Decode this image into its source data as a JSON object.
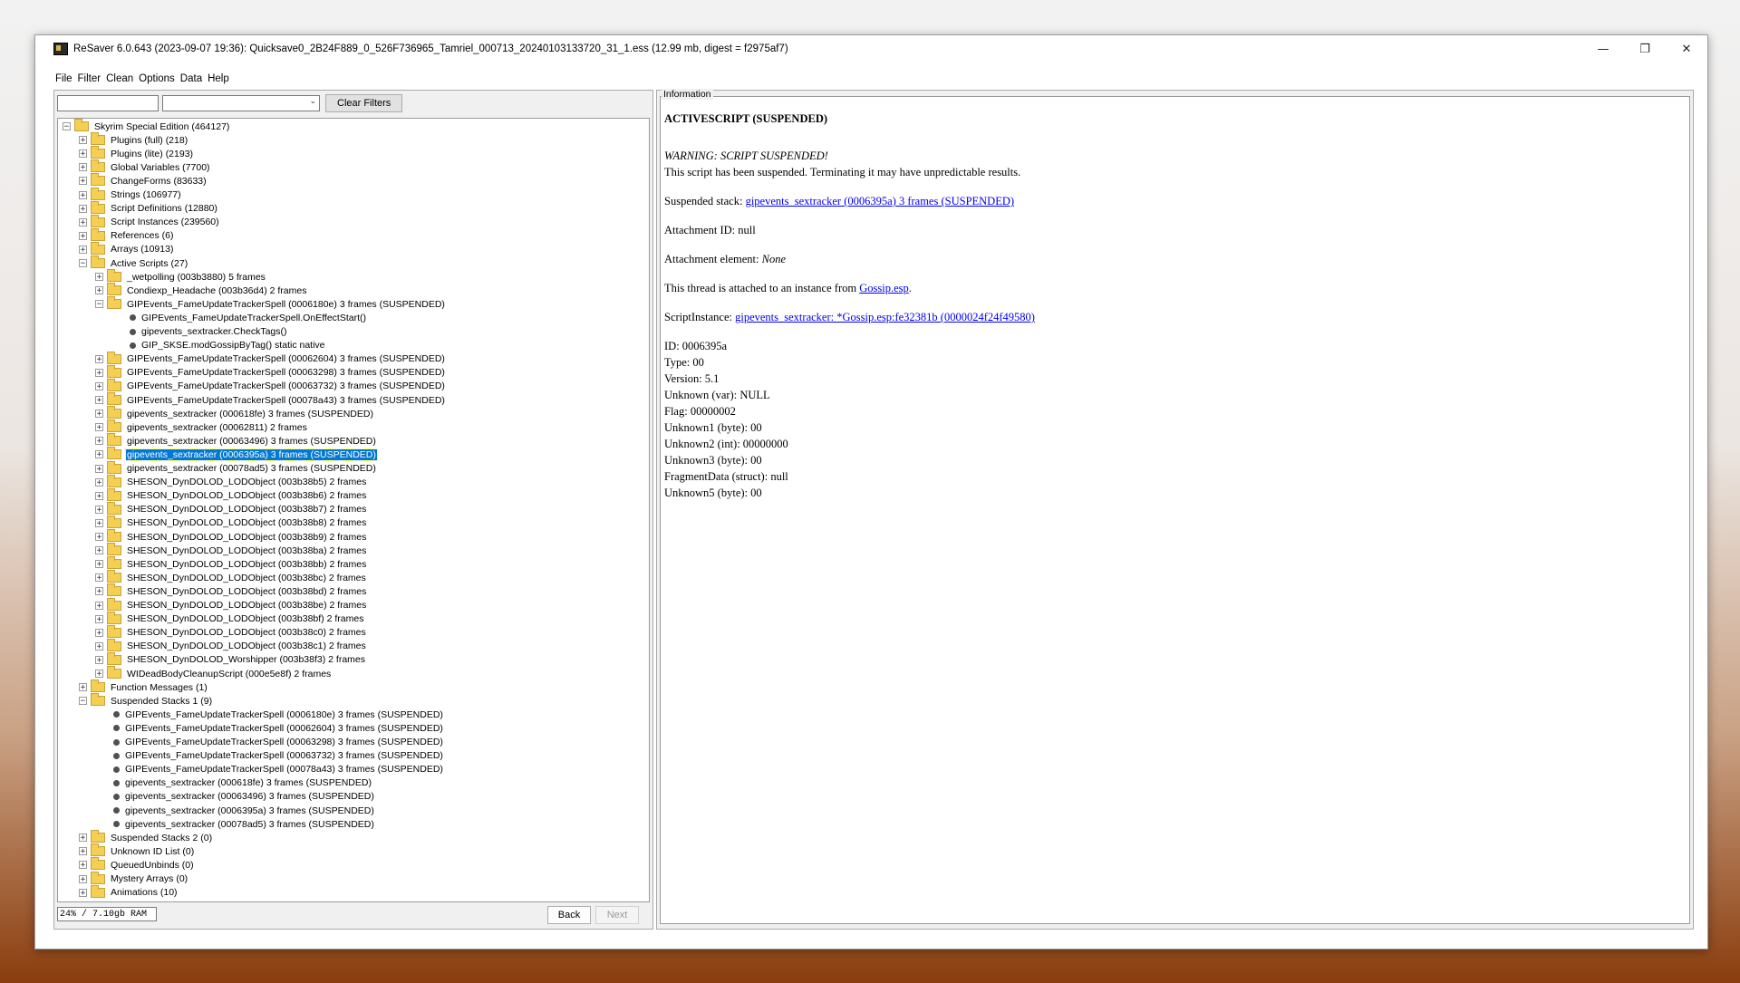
{
  "window": {
    "title": "ReSaver 6.0.643 (2023-09-07 19:36): Quicksave0_2B24F889_0_526F736965_Tamriel_000713_20240103133720_31_1.ess (12.99 mb, digest = f2975af7)",
    "controls": [
      "—",
      "❐",
      "✕"
    ]
  },
  "menu": [
    "File",
    "Filter",
    "Clean",
    "Options",
    "Data",
    "Help"
  ],
  "filters": {
    "text_value": "",
    "select_value": "",
    "clear_label": "Clear Filters"
  },
  "tree": [
    {
      "label": "Skyrim Special Edition (464127)",
      "depth": 0,
      "kind": "folder",
      "toggle": "−"
    },
    {
      "label": "Plugins (full) (218)",
      "depth": 1,
      "kind": "folder",
      "toggle": "+"
    },
    {
      "label": "Plugins (lite) (2193)",
      "depth": 1,
      "kind": "folder",
      "toggle": "+"
    },
    {
      "label": "Global Variables (7700)",
      "depth": 1,
      "kind": "folder",
      "toggle": "+"
    },
    {
      "label": "ChangeForms (83633)",
      "depth": 1,
      "kind": "folder",
      "toggle": "+"
    },
    {
      "label": "Strings (106977)",
      "depth": 1,
      "kind": "folder",
      "toggle": "+"
    },
    {
      "label": "Script Definitions (12880)",
      "depth": 1,
      "kind": "folder",
      "toggle": "+"
    },
    {
      "label": "Script Instances (239560)",
      "depth": 1,
      "kind": "folder",
      "toggle": "+"
    },
    {
      "label": "References (6)",
      "depth": 1,
      "kind": "folder",
      "toggle": "+"
    },
    {
      "label": "Arrays (10913)",
      "depth": 1,
      "kind": "folder",
      "toggle": "+"
    },
    {
      "label": "Active Scripts (27)",
      "depth": 1,
      "kind": "folder",
      "toggle": "−"
    },
    {
      "label": "_wetpolling (003b3880) 5 frames",
      "depth": 2,
      "kind": "folder",
      "toggle": "+"
    },
    {
      "label": "Condiexp_Headache (003b36d4) 2 frames",
      "depth": 2,
      "kind": "folder",
      "toggle": "+"
    },
    {
      "label": "GIPEvents_FameUpdateTrackerSpell (0006180e) 3 frames (SUSPENDED)",
      "depth": 2,
      "kind": "folder",
      "toggle": "−"
    },
    {
      "label": "GIPEvents_FameUpdateTrackerSpell.OnEffectStart()",
      "depth": 3,
      "kind": "leaf"
    },
    {
      "label": "gipevents_sextracker.CheckTags()",
      "depth": 3,
      "kind": "leaf"
    },
    {
      "label": "GIP_SKSE.modGossipByTag() static native",
      "depth": 3,
      "kind": "leaf"
    },
    {
      "label": "GIPEvents_FameUpdateTrackerSpell (00062604) 3 frames (SUSPENDED)",
      "depth": 2,
      "kind": "folder",
      "toggle": "+"
    },
    {
      "label": "GIPEvents_FameUpdateTrackerSpell (00063298) 3 frames (SUSPENDED)",
      "depth": 2,
      "kind": "folder",
      "toggle": "+"
    },
    {
      "label": "GIPEvents_FameUpdateTrackerSpell (00063732) 3 frames (SUSPENDED)",
      "depth": 2,
      "kind": "folder",
      "toggle": "+"
    },
    {
      "label": "GIPEvents_FameUpdateTrackerSpell (00078a43) 3 frames (SUSPENDED)",
      "depth": 2,
      "kind": "folder",
      "toggle": "+"
    },
    {
      "label": "gipevents_sextracker (000618fe) 3 frames (SUSPENDED)",
      "depth": 2,
      "kind": "folder",
      "toggle": "+"
    },
    {
      "label": "gipevents_sextracker (00062811) 2 frames",
      "depth": 2,
      "kind": "folder",
      "toggle": "+"
    },
    {
      "label": "gipevents_sextracker (00063496) 3 frames (SUSPENDED)",
      "depth": 2,
      "kind": "folder",
      "toggle": "+"
    },
    {
      "label": "gipevents_sextracker (0006395a) 3 frames (SUSPENDED)",
      "depth": 2,
      "kind": "folder",
      "toggle": "+",
      "selected": true
    },
    {
      "label": "gipevents_sextracker (00078ad5) 3 frames (SUSPENDED)",
      "depth": 2,
      "kind": "folder",
      "toggle": "+"
    },
    {
      "label": "SHESON_DynDOLOD_LODObject (003b38b5) 2 frames",
      "depth": 2,
      "kind": "folder",
      "toggle": "+"
    },
    {
      "label": "SHESON_DynDOLOD_LODObject (003b38b6) 2 frames",
      "depth": 2,
      "kind": "folder",
      "toggle": "+"
    },
    {
      "label": "SHESON_DynDOLOD_LODObject (003b38b7) 2 frames",
      "depth": 2,
      "kind": "folder",
      "toggle": "+"
    },
    {
      "label": "SHESON_DynDOLOD_LODObject (003b38b8) 2 frames",
      "depth": 2,
      "kind": "folder",
      "toggle": "+"
    },
    {
      "label": "SHESON_DynDOLOD_LODObject (003b38b9) 2 frames",
      "depth": 2,
      "kind": "folder",
      "toggle": "+"
    },
    {
      "label": "SHESON_DynDOLOD_LODObject (003b38ba) 2 frames",
      "depth": 2,
      "kind": "folder",
      "toggle": "+"
    },
    {
      "label": "SHESON_DynDOLOD_LODObject (003b38bb) 2 frames",
      "depth": 2,
      "kind": "folder",
      "toggle": "+"
    },
    {
      "label": "SHESON_DynDOLOD_LODObject (003b38bc) 2 frames",
      "depth": 2,
      "kind": "folder",
      "toggle": "+"
    },
    {
      "label": "SHESON_DynDOLOD_LODObject (003b38bd) 2 frames",
      "depth": 2,
      "kind": "folder",
      "toggle": "+"
    },
    {
      "label": "SHESON_DynDOLOD_LODObject (003b38be) 2 frames",
      "depth": 2,
      "kind": "folder",
      "toggle": "+"
    },
    {
      "label": "SHESON_DynDOLOD_LODObject (003b38bf) 2 frames",
      "depth": 2,
      "kind": "folder",
      "toggle": "+"
    },
    {
      "label": "SHESON_DynDOLOD_LODObject (003b38c0) 2 frames",
      "depth": 2,
      "kind": "folder",
      "toggle": "+"
    },
    {
      "label": "SHESON_DynDOLOD_LODObject (003b38c1) 2 frames",
      "depth": 2,
      "kind": "folder",
      "toggle": "+"
    },
    {
      "label": "SHESON_DynDOLOD_Worshipper (003b38f3) 2 frames",
      "depth": 2,
      "kind": "folder",
      "toggle": "+"
    },
    {
      "label": "WIDeadBodyCleanupScript (000e5e8f) 2 frames",
      "depth": 2,
      "kind": "folder",
      "toggle": "+"
    },
    {
      "label": "Function Messages (1)",
      "depth": 1,
      "kind": "folder",
      "toggle": "+"
    },
    {
      "label": "Suspended Stacks 1 (9)",
      "depth": 1,
      "kind": "folder",
      "toggle": "−"
    },
    {
      "label": "GIPEvents_FameUpdateTrackerSpell (0006180e) 3 frames (SUSPENDED)",
      "depth": 2,
      "kind": "leaf"
    },
    {
      "label": "GIPEvents_FameUpdateTrackerSpell (00062604) 3 frames (SUSPENDED)",
      "depth": 2,
      "kind": "leaf"
    },
    {
      "label": "GIPEvents_FameUpdateTrackerSpell (00063298) 3 frames (SUSPENDED)",
      "depth": 2,
      "kind": "leaf"
    },
    {
      "label": "GIPEvents_FameUpdateTrackerSpell (00063732) 3 frames (SUSPENDED)",
      "depth": 2,
      "kind": "leaf"
    },
    {
      "label": "GIPEvents_FameUpdateTrackerSpell (00078a43) 3 frames (SUSPENDED)",
      "depth": 2,
      "kind": "leaf"
    },
    {
      "label": "gipevents_sextracker (000618fe) 3 frames (SUSPENDED)",
      "depth": 2,
      "kind": "leaf"
    },
    {
      "label": "gipevents_sextracker (00063496) 3 frames (SUSPENDED)",
      "depth": 2,
      "kind": "leaf"
    },
    {
      "label": "gipevents_sextracker (0006395a) 3 frames (SUSPENDED)",
      "depth": 2,
      "kind": "leaf"
    },
    {
      "label": "gipevents_sextracker (00078ad5) 3 frames (SUSPENDED)",
      "depth": 2,
      "kind": "leaf"
    },
    {
      "label": "Suspended Stacks 2 (0)",
      "depth": 1,
      "kind": "folder",
      "toggle": "+"
    },
    {
      "label": "Unknown ID List (0)",
      "depth": 1,
      "kind": "folder",
      "toggle": "+"
    },
    {
      "label": "QueuedUnbinds (0)",
      "depth": 1,
      "kind": "folder",
      "toggle": "+"
    },
    {
      "label": "Mystery Arrays (0)",
      "depth": 1,
      "kind": "folder",
      "toggle": "+"
    },
    {
      "label": "Animations (10)",
      "depth": 1,
      "kind": "folder",
      "toggle": "+"
    }
  ],
  "status": {
    "ram": "24% / 7.10gb RAM",
    "back_label": "Back",
    "next_label": "Next"
  },
  "info": {
    "legend": "Information",
    "heading": "ACTIVESCRIPT (SUSPENDED)",
    "warning_title": "WARNING: SCRIPT SUSPENDED!",
    "warning_text": "This script has been suspended. Terminating it may have unpredictable results.",
    "suspended_prefix": "Suspended stack: ",
    "suspended_link": "gipevents_sextracker (0006395a) 3 frames (SUSPENDED)",
    "attachment_id": "Attachment ID: null",
    "attachment_element_prefix": "Attachment element: ",
    "attachment_element_value": "None",
    "thread_prefix": "This thread is attached to an instance from ",
    "thread_link": "Gossip.esp",
    "thread_suffix": ".",
    "script_instance_prefix": "ScriptInstance: ",
    "script_instance_link": "gipevents_sextracker: *Gossip.esp:fe32381b (0000024f24f49580)",
    "fields": [
      "ID: 0006395a",
      "Type: 00",
      "Version: 5.1",
      "Unknown (var): NULL",
      "Flag: 00000002",
      "Unknown1 (byte): 00",
      "Unknown2 (int): 00000000",
      "Unknown3 (byte): 00",
      "FragmentData (struct): null",
      "Unknown5 (byte): 00"
    ]
  }
}
